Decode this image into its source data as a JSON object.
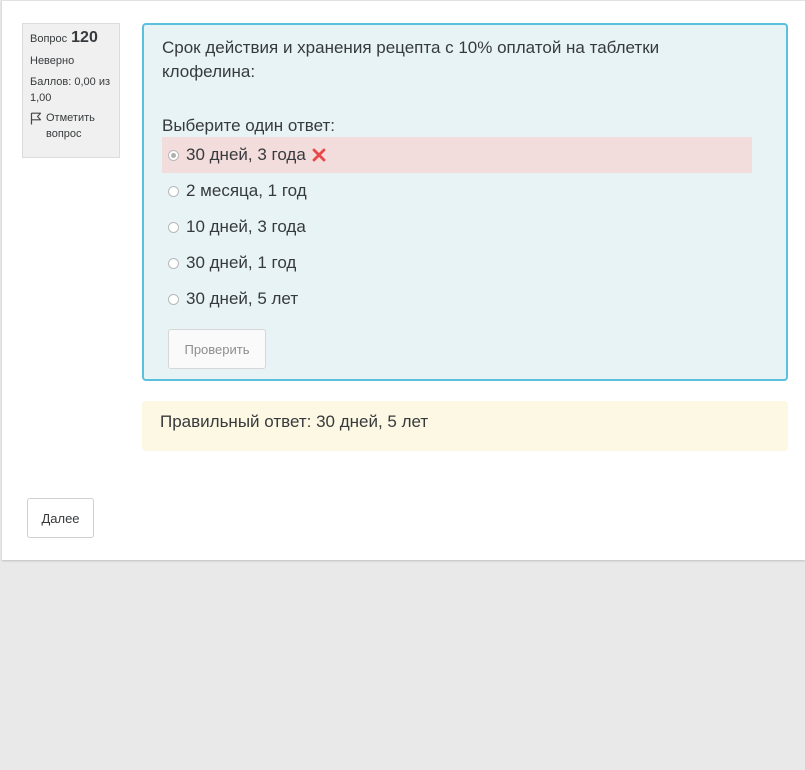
{
  "question_info": {
    "label": "Вопрос",
    "number": "120",
    "state": "Неверно",
    "grade": "Баллов: 0,00 из 1,00",
    "flag_label": "Отметить вопрос"
  },
  "question": {
    "text": "Срок действия и хранения рецепта с 10% оплатой на таблетки клофелина:",
    "prompt": "Выберите один ответ:",
    "options": [
      {
        "label": "30 дней, 3 года",
        "selected": true,
        "status": "incorrect"
      },
      {
        "label": "2 месяца, 1 год",
        "selected": false
      },
      {
        "label": "10 дней, 3 года",
        "selected": false
      },
      {
        "label": "30 дней, 1 год",
        "selected": false
      },
      {
        "label": "30 дней, 5 лет",
        "selected": false
      }
    ],
    "check_button": "Проверить"
  },
  "feedback": {
    "right_answer": "Правильный ответ: 30 дней, 5 лет"
  },
  "navigation": {
    "next_button": "Далее"
  },
  "colors": {
    "formulation_bg": "#e7f3f5",
    "formulation_border": "#5bc0de",
    "incorrect_bg": "#f3dcdc",
    "incorrect_icon": "#e8484a",
    "feedback_bg": "#fcf8e3"
  },
  "icons": [
    "flag-icon",
    "incorrect-x-icon"
  ]
}
